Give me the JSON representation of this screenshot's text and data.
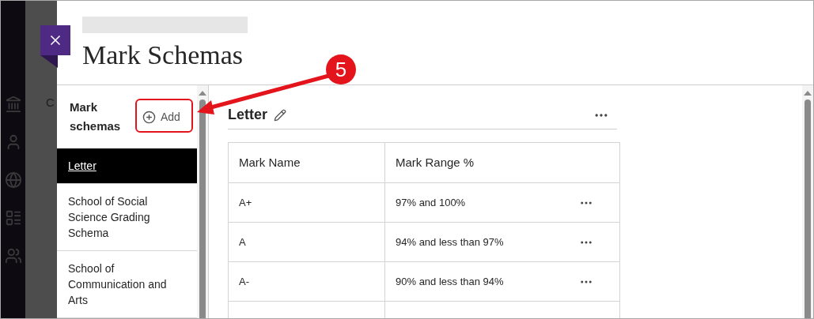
{
  "background": {
    "nav_text": "C"
  },
  "dialog": {
    "title": "Mark Schemas",
    "sidebar": {
      "heading": "Mark schemas",
      "add_button": "Add",
      "items": [
        {
          "label": "Letter",
          "selected": true
        },
        {
          "label": "School of Social Science Grading Schema",
          "selected": false
        },
        {
          "label": "School of Communication and Arts",
          "selected": false
        }
      ]
    },
    "schema": {
      "name": "Letter",
      "table": {
        "columns": [
          "Mark Name",
          "Mark Range %"
        ],
        "rows": [
          {
            "mark_name": "A+",
            "mark_range": "97% and 100%"
          },
          {
            "mark_name": "A",
            "mark_range": "94% and less than 97%"
          },
          {
            "mark_name": "A-",
            "mark_range": "90% and less than 94%"
          }
        ]
      }
    }
  },
  "annotation": {
    "step": "5"
  }
}
